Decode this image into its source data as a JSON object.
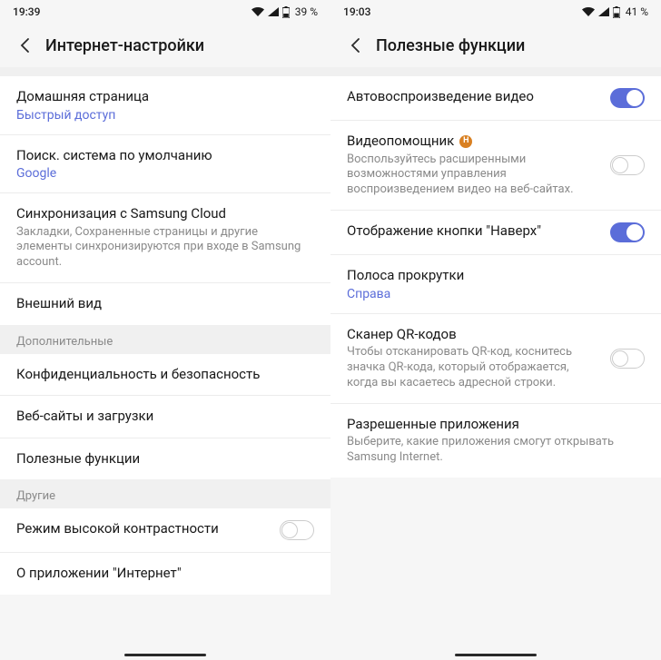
{
  "left": {
    "status": {
      "time": "19:39",
      "battery": "39 %"
    },
    "header": {
      "title": "Интернет-настройки"
    },
    "group1": [
      {
        "title": "Домашняя страница",
        "value": "Быстрый доступ"
      },
      {
        "title": "Поиск. система по умолчанию",
        "value": "Google"
      },
      {
        "title": "Синхронизация с Samsung Cloud",
        "sub": "Закладки, Сохраненные страницы и другие элементы синхронизируются при входе в Samsung account."
      },
      {
        "title": "Внешний вид"
      }
    ],
    "section2": "Дополнительные",
    "group2": [
      {
        "title": "Конфиденциальность и безопасность"
      },
      {
        "title": "Веб-сайты и загрузки"
      },
      {
        "title": "Полезные функции"
      }
    ],
    "section3": "Другие",
    "group3": [
      {
        "title": "Режим высокой контрастности",
        "toggle": false
      },
      {
        "title": "О приложении \"Интернет\""
      }
    ]
  },
  "right": {
    "status": {
      "time": "19:03",
      "battery": "41 %"
    },
    "header": {
      "title": "Полезные функции"
    },
    "group1": [
      {
        "title": "Автовоспроизведение видео",
        "toggle": true
      },
      {
        "title": "Видеопомощник",
        "badge": "Н",
        "sub": "Воспользуйтесь расширенными возможностями управления воспроизведением видео на веб-сайтах.",
        "toggle": false
      },
      {
        "title": "Отображение кнопки \"Наверх\"",
        "toggle": true
      },
      {
        "title": "Полоса прокрутки",
        "value": "Справа"
      },
      {
        "title": "Сканер QR-кодов",
        "sub": "Чтобы отсканировать QR-код, коснитесь значка QR-кода, который отображается, когда вы касаетесь адресной строки.",
        "toggle": false
      },
      {
        "title": "Разрешенные приложения",
        "sub": "Выберите, какие приложения смогут открывать Samsung Internet."
      }
    ]
  }
}
